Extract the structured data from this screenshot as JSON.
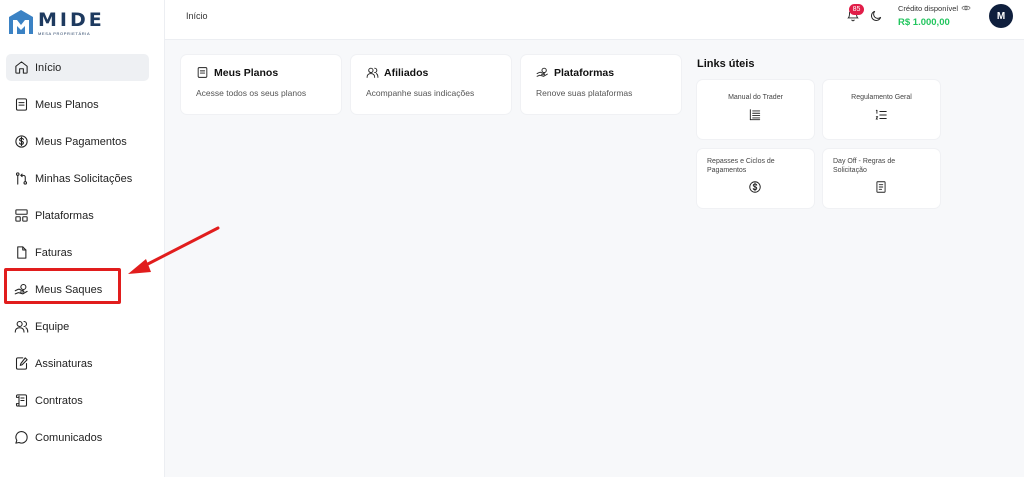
{
  "brand": {
    "name": "MIDE",
    "tagline": "MESA PROPRIETÁRIA",
    "color": "#1e3a5f"
  },
  "sidebar": {
    "items": [
      {
        "label": "Início",
        "icon": "home-icon",
        "active": true
      },
      {
        "label": "Meus Planos",
        "icon": "plan-icon"
      },
      {
        "label": "Meus Pagamentos",
        "icon": "dollar-circle-icon"
      },
      {
        "label": "Minhas Solicitações",
        "icon": "git-pull-icon"
      },
      {
        "label": "Plataformas",
        "icon": "layout-icon"
      },
      {
        "label": "Faturas",
        "icon": "file-icon"
      },
      {
        "label": "Meus Saques",
        "icon": "withdraw-hand-icon"
      },
      {
        "label": "Equipe",
        "icon": "users-icon"
      },
      {
        "label": "Assinaturas",
        "icon": "signature-icon"
      },
      {
        "label": "Contratos",
        "icon": "scroll-icon"
      },
      {
        "label": "Comunicados",
        "icon": "message-circle-icon"
      }
    ]
  },
  "header": {
    "breadcrumb": "Início",
    "notifications": "85",
    "credit_label": "Crédito disponível",
    "credit_value": "R$ 1.000,00",
    "avatar_initial": "M"
  },
  "cards": [
    {
      "title": "Meus Planos",
      "desc": "Acesse todos os seus planos",
      "icon": "plan-icon"
    },
    {
      "title": "Afiliados",
      "desc": "Acompanhe suas indicações",
      "icon": "users-icon"
    },
    {
      "title": "Plataformas",
      "desc": "Renove suas plataformas",
      "icon": "withdraw-hand-icon"
    }
  ],
  "links": {
    "title": "Links úteis",
    "items": [
      {
        "label": "Manual do Trader",
        "icon": "list-icon"
      },
      {
        "label": "Regulamento Geral",
        "icon": "list-ordered-icon"
      },
      {
        "label": "Repasses e Ciclos de Pagamentos",
        "icon": "dollar-circle-icon"
      },
      {
        "label": "Day Off - Regras de Solicitação",
        "icon": "document-icon"
      }
    ]
  },
  "colors": {
    "accent_green": "#22c55e",
    "badge": "#e11d48",
    "annotation_red": "#e11d1d"
  }
}
